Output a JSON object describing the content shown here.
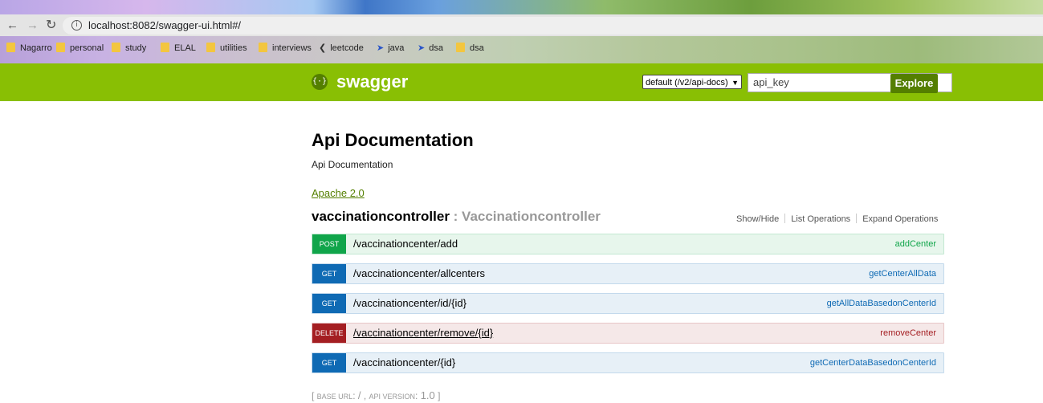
{
  "browser": {
    "url": "localhost:8082/swagger-ui.html#/",
    "bookmarks": [
      {
        "label": "Nagarro",
        "icon": "folder-icon"
      },
      {
        "label": "personal",
        "icon": "folder-icon"
      },
      {
        "label": "study",
        "icon": "folder-icon"
      },
      {
        "label": "ELAL",
        "icon": "folder-icon"
      },
      {
        "label": "utilities",
        "icon": "folder-icon"
      },
      {
        "label": "interviews",
        "icon": "folder-icon"
      },
      {
        "label": "leetcode",
        "icon": "leetcode-icon"
      },
      {
        "label": "java",
        "icon": "arrow-bookmark-icon"
      },
      {
        "label": "dsa",
        "icon": "arrow-bookmark-icon"
      },
      {
        "label": "dsa",
        "icon": "folder-icon"
      }
    ]
  },
  "header": {
    "logo_text": "swagger",
    "spec_select": "default (/v2/api-docs)",
    "api_key_placeholder": "api_key",
    "explore_label": "Explore",
    "colors": {
      "bar": "#89bf04",
      "button": "#547f00"
    }
  },
  "info": {
    "title": "Api Documentation",
    "description": "Api Documentation",
    "license": "Apache 2.0"
  },
  "resource": {
    "name": "vaccinationcontroller",
    "separator": " : ",
    "description": "Vaccinationcontroller",
    "links": [
      "Show/Hide",
      "List Operations",
      "Expand Operations"
    ],
    "operations": [
      {
        "method": "POST",
        "path": "/vaccinationcenter/add",
        "nickname": "addCenter"
      },
      {
        "method": "GET",
        "path": "/vaccinationcenter/allcenters",
        "nickname": "getCenterAllData"
      },
      {
        "method": "GET",
        "path": "/vaccinationcenter/id/{id}",
        "nickname": "getAllDataBasedonCenterId"
      },
      {
        "method": "DELETE",
        "path": "/vaccinationcenter/remove/{id}",
        "nickname": "removeCenter"
      },
      {
        "method": "GET",
        "path": "/vaccinationcenter/{id}",
        "nickname": "getCenterDataBasedonCenterId"
      }
    ]
  },
  "footer": {
    "open": "[ ",
    "base_url_label": "BASE URL",
    "base_url_value": "/",
    "sep": " , ",
    "api_version_label": "API VERSION",
    "api_version_value": "1.0",
    "close": " ]"
  }
}
